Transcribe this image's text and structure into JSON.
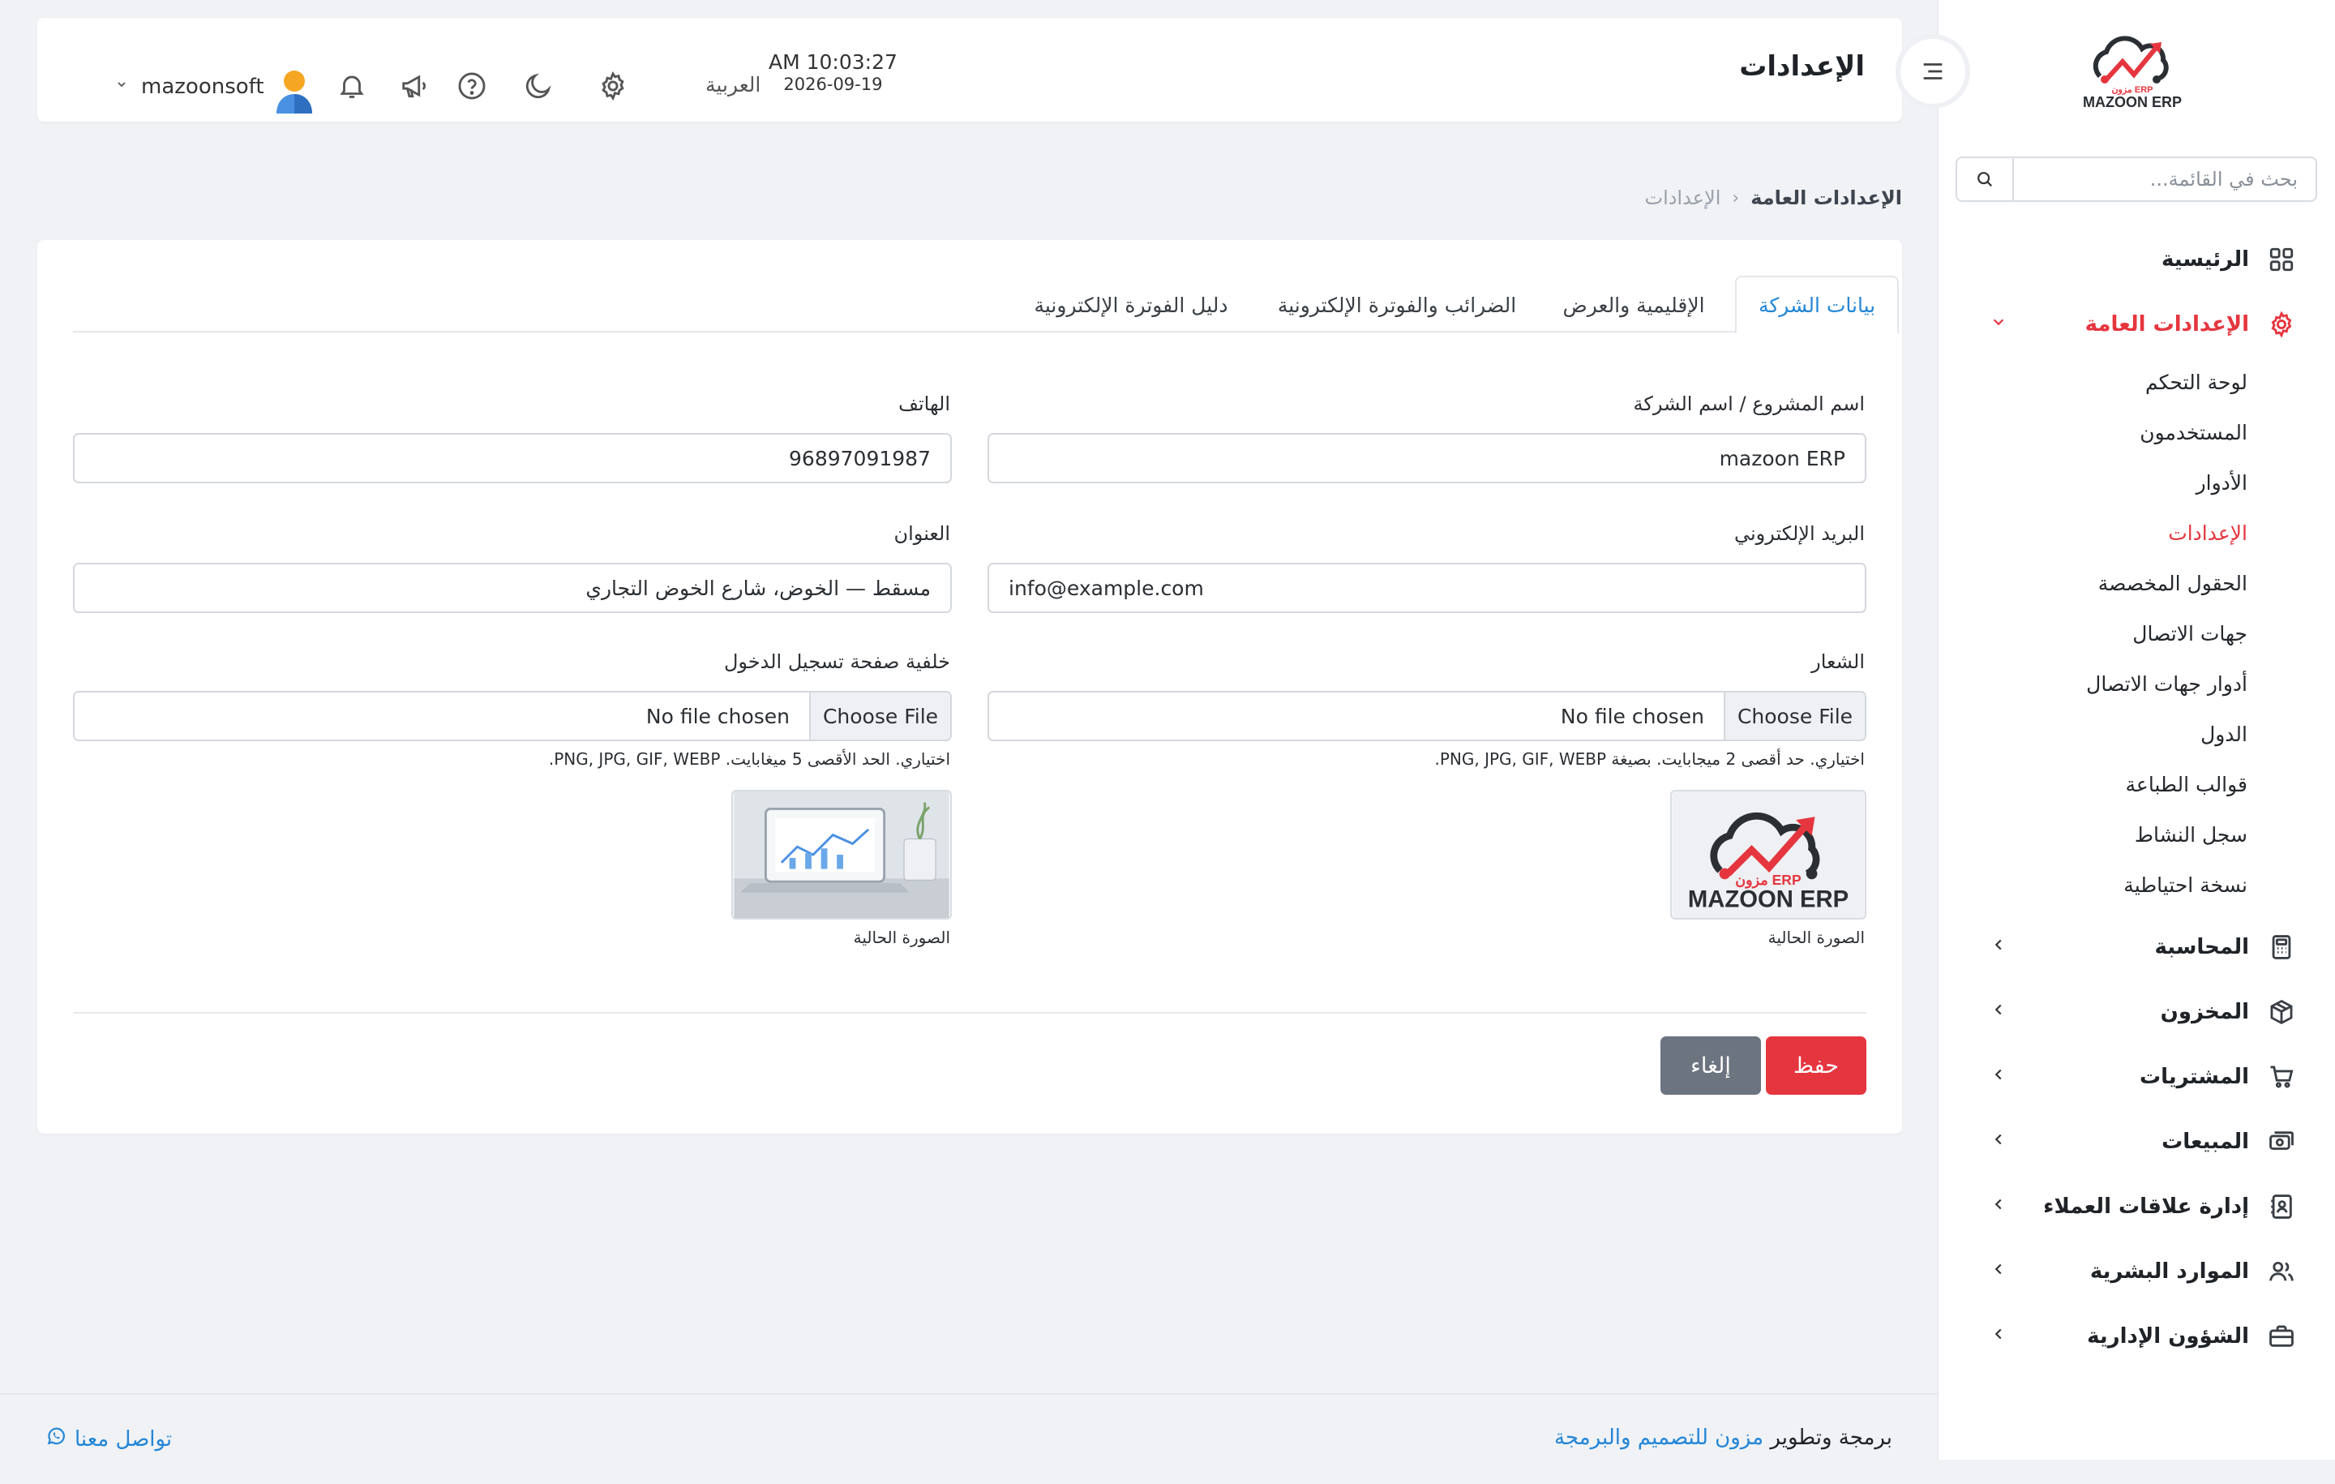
{
  "brand": {
    "name": "MAZOON ERP",
    "arabic": "مزون ERP"
  },
  "sidebar": {
    "search_placeholder": "بحث في القائمة...",
    "items": [
      {
        "label": "الرئيسية",
        "icon": "grid-icon"
      },
      {
        "label": "الإعدادات العامة",
        "icon": "gear-icon",
        "expanded": true
      },
      {
        "label": "المحاسبة",
        "icon": "calculator-icon"
      },
      {
        "label": "المخزون",
        "icon": "box-icon"
      },
      {
        "label": "المشتريات",
        "icon": "cart-icon"
      },
      {
        "label": "المبيعات",
        "icon": "cash-icon"
      },
      {
        "label": "إدارة علاقات العملاء",
        "icon": "contacts-book-icon"
      },
      {
        "label": "الموارد البشرية",
        "icon": "users-icon"
      },
      {
        "label": "الشؤون الإدارية",
        "icon": "briefcase-icon"
      }
    ],
    "sub_items": [
      {
        "label": "لوحة التحكم"
      },
      {
        "label": "المستخدمون"
      },
      {
        "label": "الأدوار"
      },
      {
        "label": "الإعدادات",
        "active": true
      },
      {
        "label": "الحقول المخصصة"
      },
      {
        "label": "جهات الاتصال"
      },
      {
        "label": "أدوار جهات الاتصال"
      },
      {
        "label": "الدول"
      },
      {
        "label": "قوالب الطباعة"
      },
      {
        "label": "سجل النشاط"
      },
      {
        "label": "نسخة احتياطية"
      }
    ]
  },
  "header": {
    "title": "الإعدادات",
    "time": "AM 10:03:27",
    "date": "2026-09-19",
    "language": "العربية",
    "username": "mazoonsoft"
  },
  "breadcrumb": {
    "current": "الإعدادات العامة",
    "parent": "الإعدادات",
    "separator": "‹"
  },
  "tabs": [
    {
      "label": "بيانات الشركة",
      "active": true
    },
    {
      "label": "الإقليمية والعرض"
    },
    {
      "label": "الضرائب والفوترة الإلكترونية"
    },
    {
      "label": "دليل الفوترة الإلكترونية"
    }
  ],
  "form": {
    "company_label": "اسم المشروع / اسم الشركة",
    "company_value": "mazoon ERP",
    "phone_label": "الهاتف",
    "phone_value": "96897091987",
    "email_label": "البريد الإلكتروني",
    "email_value": "info@example.com",
    "address_label": "العنوان",
    "address_value": "مسقط — الخوض، شارع الخوض التجاري",
    "logo_label": "الشعار",
    "logo_hint": "اختياري. حد أقصى 2 ميجابايت. بصيغة PNG, JPG, GIF, WEBP.",
    "bg_label": "خلفية صفحة تسجيل الدخول",
    "bg_hint": "اختياري. الحد الأقصى 5 ميغابايت. PNG, JPG, GIF, WEBP.",
    "choose_file": "Choose File",
    "no_file": "No file chosen",
    "current_image": "الصورة الحالية"
  },
  "actions": {
    "save": "حفظ",
    "cancel": "إلغاء"
  },
  "footer": {
    "credit_prefix": "برمجة وتطوير",
    "credit_link": "مزون للتصميم والبرمجة",
    "contact": "تواصل معنا"
  },
  "colors": {
    "accent": "#e5363f",
    "link": "#2386d6",
    "cancel": "#6c7480"
  }
}
